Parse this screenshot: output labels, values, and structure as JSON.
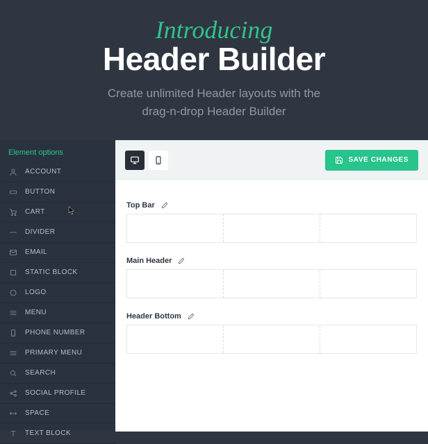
{
  "hero": {
    "script": "Introducing",
    "title": "Header Builder",
    "sub_l1": "Create unlimited Header layouts with the",
    "sub_l2": "drag-n-drop Header Builder"
  },
  "sidebar": {
    "title": "Element options",
    "items": [
      {
        "label": "ACCOUNT",
        "icon": "user"
      },
      {
        "label": "BUTTON",
        "icon": "rect"
      },
      {
        "label": "CART",
        "icon": "cart"
      },
      {
        "label": "DIVIDER",
        "icon": "line"
      },
      {
        "label": "EMAIL",
        "icon": "mail"
      },
      {
        "label": "STATIC BLOCK",
        "icon": "square"
      },
      {
        "label": "LOGO",
        "icon": "circle"
      },
      {
        "label": "MENU",
        "icon": "menu"
      },
      {
        "label": "PHONE NUMBER",
        "icon": "phone"
      },
      {
        "label": "PRIMARY MENU",
        "icon": "menu"
      },
      {
        "label": "SEARCH",
        "icon": "search"
      },
      {
        "label": "SOCIAL PROFILE",
        "icon": "share"
      },
      {
        "label": "SPACE",
        "icon": "arrows"
      },
      {
        "label": "TEXT BLOCK",
        "icon": "text"
      }
    ]
  },
  "toolbar": {
    "save_label": "SAVE CHANGES"
  },
  "rows": [
    {
      "label": "Top Bar",
      "cols": 3
    },
    {
      "label": "Main Header",
      "cols": 3
    },
    {
      "label": "Header Bottom",
      "cols": 3
    }
  ]
}
